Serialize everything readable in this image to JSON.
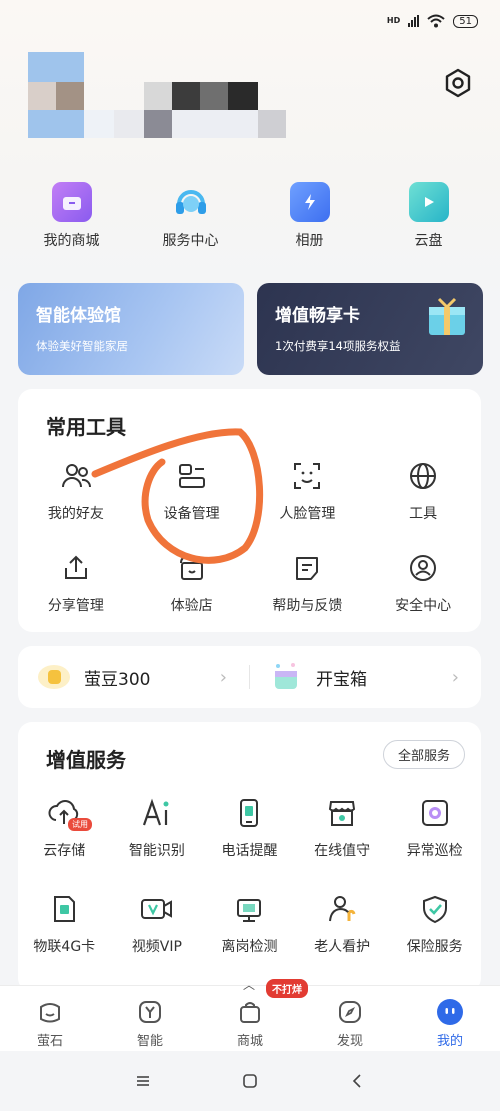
{
  "status_bar": {
    "network": "HD",
    "battery": "51"
  },
  "quick_links": [
    {
      "label": "我的商城",
      "icon": "shop-bag-icon"
    },
    {
      "label": "服务中心",
      "icon": "headset-icon"
    },
    {
      "label": "相册",
      "icon": "album-icon"
    },
    {
      "label": "云盘",
      "icon": "cloud-drive-icon"
    }
  ],
  "banners": {
    "left": {
      "title": "智能体验馆",
      "subtitle": "体验美好智能家居"
    },
    "right": {
      "title": "增值畅享卡",
      "subtitle": "1次付费享14项服务权益"
    }
  },
  "tools": {
    "title": "常用工具",
    "items": [
      {
        "label": "我的好友",
        "icon": "friends-icon"
      },
      {
        "label": "设备管理",
        "icon": "device-manage-icon"
      },
      {
        "label": "人脸管理",
        "icon": "face-scan-icon"
      },
      {
        "label": "工具",
        "icon": "globe-icon"
      },
      {
        "label": "分享管理",
        "icon": "share-icon"
      },
      {
        "label": "体验店",
        "icon": "store-icon"
      },
      {
        "label": "帮助与反馈",
        "icon": "feedback-icon"
      },
      {
        "label": "安全中心",
        "icon": "security-icon"
      }
    ]
  },
  "rewards": {
    "beans": "萤豆300",
    "treasure": "开宝箱"
  },
  "services": {
    "title": "增值服务",
    "all_button": "全部服务",
    "trial_badge": "试用",
    "items": [
      {
        "label": "云存储",
        "icon": "cloud-upload-icon"
      },
      {
        "label": "智能识别",
        "icon": "ai-icon"
      },
      {
        "label": "电话提醒",
        "icon": "phone-icon"
      },
      {
        "label": "在线值守",
        "icon": "shop-guard-icon"
      },
      {
        "label": "异常巡检",
        "icon": "inspect-icon"
      },
      {
        "label": "物联4G卡",
        "icon": "sim-card-icon"
      },
      {
        "label": "视频VIP",
        "icon": "video-vip-icon"
      },
      {
        "label": "离岗检测",
        "icon": "desk-detect-icon"
      },
      {
        "label": "老人看护",
        "icon": "elder-care-icon"
      },
      {
        "label": "保险服务",
        "icon": "shield-check-icon"
      }
    ]
  },
  "bottom_nav": {
    "badge": "不打烊",
    "items": [
      {
        "label": "萤石",
        "icon": "ezviz-home-icon"
      },
      {
        "label": "智能",
        "icon": "smart-icon"
      },
      {
        "label": "商城",
        "icon": "mall-bag-icon"
      },
      {
        "label": "发现",
        "icon": "compass-icon"
      },
      {
        "label": "我的",
        "icon": "profile-face-icon",
        "active": true
      }
    ]
  },
  "colors": {
    "accent": "#2f6ae8",
    "annotation": "#f0743a"
  }
}
